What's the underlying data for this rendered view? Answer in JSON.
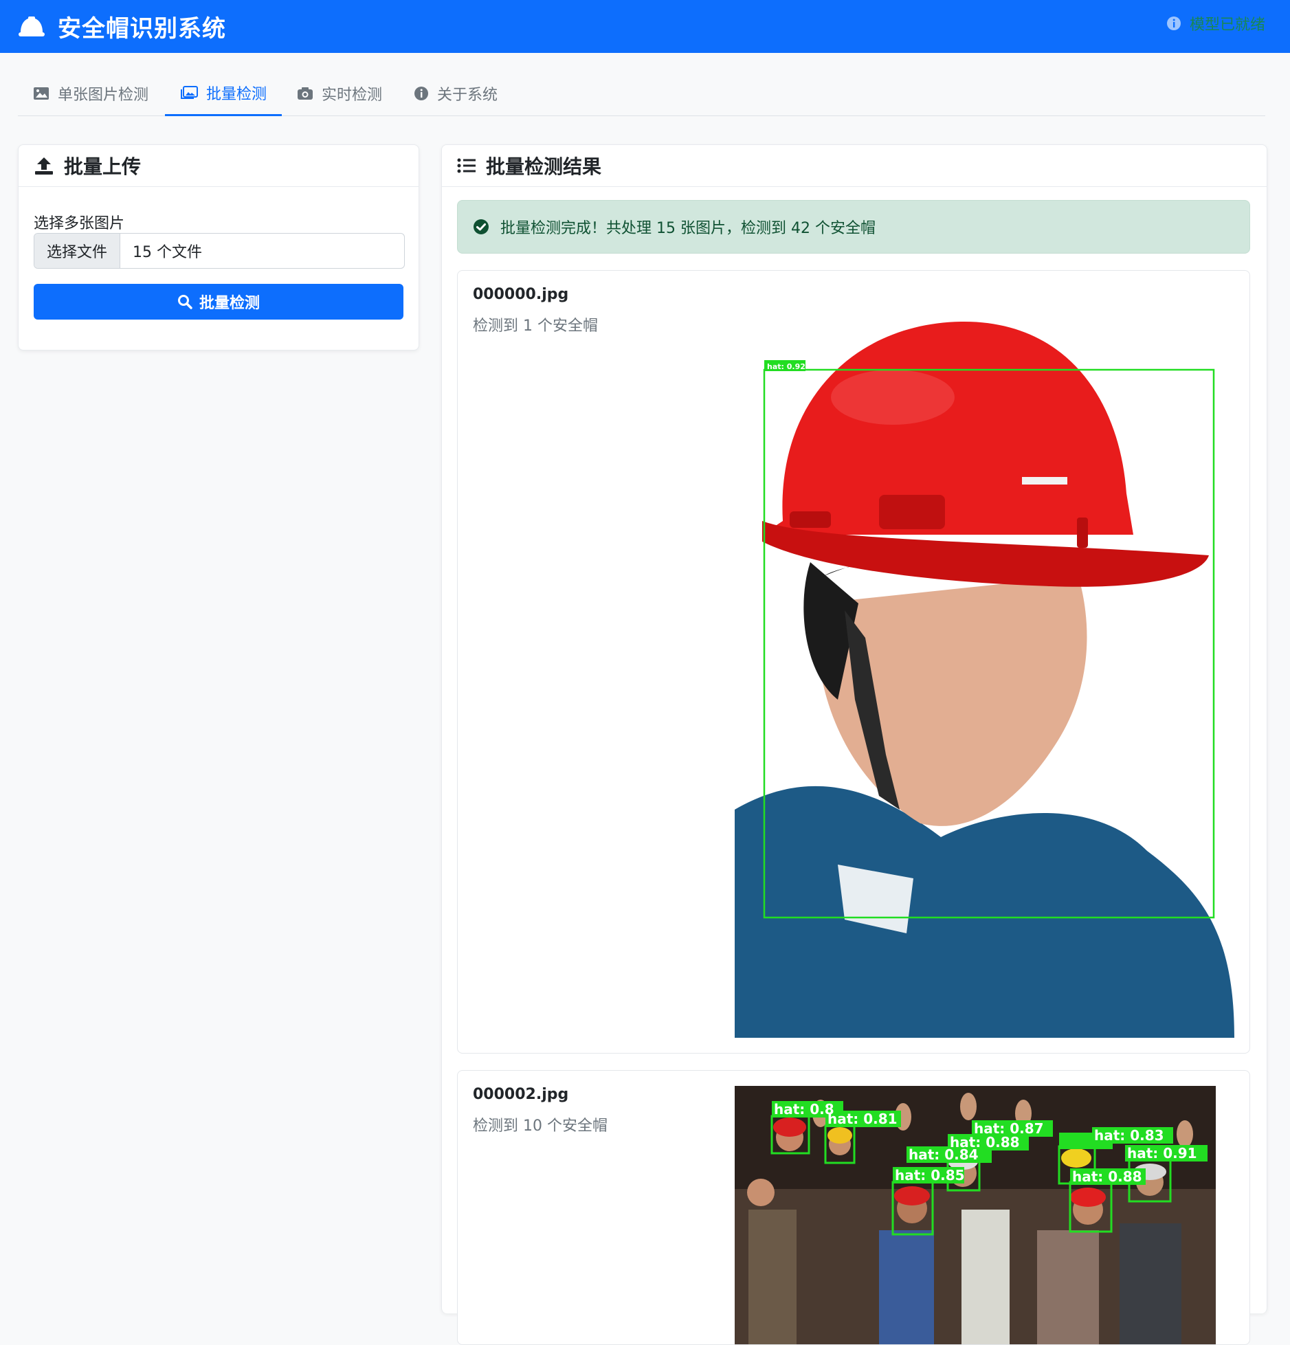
{
  "header": {
    "title": "安全帽识别系统",
    "status": "模型已就绪"
  },
  "tabs": [
    {
      "label": "单张图片检测"
    },
    {
      "label": "批量检测"
    },
    {
      "label": "实时检测"
    },
    {
      "label": "关于系统"
    }
  ],
  "upload": {
    "title": "批量上传",
    "select_label": "选择多张图片",
    "file_button": "选择文件",
    "file_text": "15 个文件",
    "detect_button": "批量检测"
  },
  "results": {
    "title": "批量检测结果",
    "alert": "批量检测完成！共处理 15 张图片，检测到 42 个安全帽",
    "items": [
      {
        "filename": "000000.jpg",
        "count_text": "检测到 1 个安全帽",
        "labels": [
          "hat: 0.92"
        ]
      },
      {
        "filename": "000002.jpg",
        "count_text": "检测到 10 个安全帽",
        "labels": [
          "hat: 0.8",
          "hat: 0.81",
          "hat: 0.88",
          "hat: 0.87",
          "hat: 0.84",
          "hat: 0.83",
          "hat: 0.91",
          "hat: 0.85",
          "hat: 0.88"
        ]
      }
    ]
  },
  "colors": {
    "primary": "#0d6efd",
    "success_text": "#0f5132",
    "success_bg": "#d1e7dd",
    "detect_box": "#22dd22"
  }
}
